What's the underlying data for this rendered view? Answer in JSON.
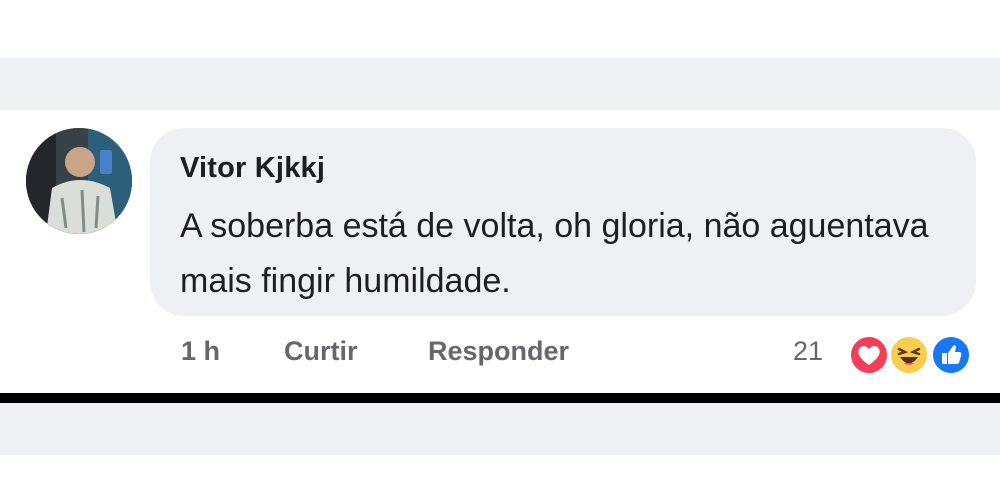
{
  "comment": {
    "author": "Vitor Kjkkj",
    "text": "A soberba está de volta, oh gloria, não aguentava mais fingir humildade.",
    "time": "1 h",
    "like_label": "Curtir",
    "reply_label": "Responder",
    "reaction_count": "21",
    "reactions": [
      "love-icon",
      "haha-icon",
      "like-icon"
    ]
  },
  "colors": {
    "bubble": "#eff0f3",
    "text": "#1c1e21",
    "meta": "#65676b",
    "love": "#f33e58",
    "haha": "#fbcd4e",
    "like": "#1877f2"
  }
}
